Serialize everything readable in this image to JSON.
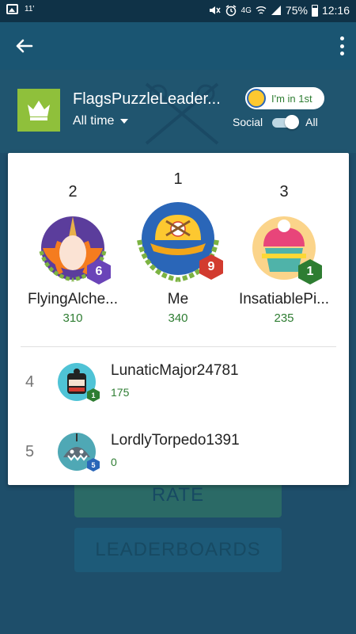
{
  "status_bar": {
    "signal_label": "11'",
    "network": "4G",
    "battery": "75%",
    "time": "12:16"
  },
  "header": {
    "title": "FlagsPuzzleLeader...",
    "time_filter": "All time",
    "rank_pill": "I'm in 1st",
    "social_label": "Social",
    "all_label": "All"
  },
  "podium": [
    {
      "rank": "2",
      "name": "FlyingAlche...",
      "score": "310",
      "level": "6",
      "badge_color": "#6a44b8"
    },
    {
      "rank": "1",
      "name": "Me",
      "score": "340",
      "level": "9",
      "badge_color": "#d23b2f"
    },
    {
      "rank": "3",
      "name": "InsatiablePi...",
      "score": "235",
      "level": "1",
      "badge_color": "#2e7d32"
    }
  ],
  "rows": [
    {
      "rank": "4",
      "name": "LunaticMajor24781",
      "score": "175",
      "level": "1"
    },
    {
      "rank": "5",
      "name": "LordlyTorpedo1391",
      "score": "0",
      "level": "5"
    }
  ],
  "background_buttons": {
    "rate": "RATE",
    "leaderboards": "LEADERBOARDS"
  },
  "icons": [
    "image-icon",
    "mute-icon",
    "alarm-icon",
    "wifi-icon",
    "signal-icon",
    "battery-icon",
    "back-arrow-icon",
    "more-vert-icon",
    "crown-icon"
  ],
  "colors": {
    "accent_green": "#2e7d32",
    "app_bar": "#1a5572",
    "logo_green": "#8fc03b"
  }
}
